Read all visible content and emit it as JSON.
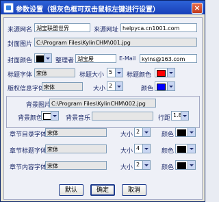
{
  "window": {
    "title": "参数设置（银灰色框可双击鼠标左键进行设置）",
    "close_label": "×"
  },
  "source": {
    "name_label": "来源网名",
    "name_value": "湖宝联盟世界",
    "url_label": "来源网址",
    "url_value": "helpyca.cn1001.com"
  },
  "cover": {
    "label": "封面图片",
    "value": "C:\\Program Files\\KylinCHM\\001.jpg"
  },
  "cover_color": {
    "label": "封面颜色",
    "swatch": "#000000"
  },
  "organizer": {
    "label": "整理者",
    "value": "湖宝屋",
    "email_label": "E-Mail",
    "email_value": "kylns@163.com"
  },
  "title_font": {
    "label": "标题字体",
    "value": "宋体",
    "size_label": "标题大小",
    "size_value": "5",
    "color_label": "标题颜色",
    "color_swatch": "#ff0000"
  },
  "copyright": {
    "label": "版权信息字体",
    "value": "宋体",
    "size_label": "大小",
    "size_value": "2",
    "color_label": "颜色",
    "color_swatch": "#0000ff"
  },
  "background": {
    "image_label": "背景图片",
    "image_value": "C:\\Program Files\\KylinCHM\\002.jpg",
    "color_label": "背景颜色",
    "color_swatch": "#ffffff",
    "music_label": "背景音乐",
    "music_value": "",
    "spacing_label": "行距",
    "spacing_value": "1.8"
  },
  "chapter_dir": {
    "label": "章节目录字体",
    "value": "宋体",
    "size_label": "大小",
    "size_value": "2",
    "color_label": "颜色",
    "color_swatch": "#000000"
  },
  "chapter_title": {
    "label": "章节标题字体",
    "value": "宋体",
    "size_label": "大小",
    "size_value": "4",
    "color_label": "颜色",
    "color_swatch": "#000000"
  },
  "chapter_content": {
    "label": "章节内容字体",
    "value": "宋体",
    "size_label": "大小",
    "size_value": "2",
    "color_label": "颜色",
    "color_swatch": "#000000"
  },
  "buttons": {
    "default": "默认",
    "ok": "确定",
    "cancel": "取消"
  }
}
